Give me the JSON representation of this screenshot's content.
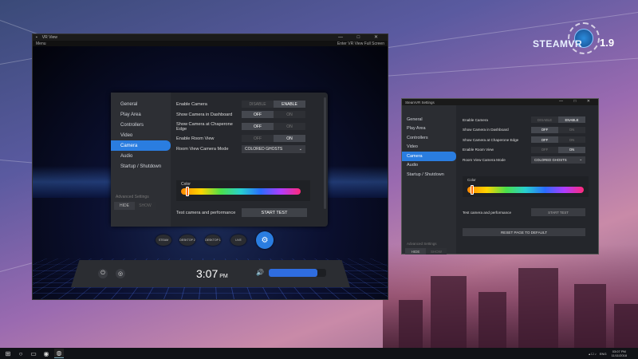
{
  "colors": {
    "accent": "#2a7de0",
    "volume": "#2f6de0"
  },
  "logo": {
    "word": "STEAMVR",
    "version": "1.9"
  },
  "vrview": {
    "title": "VR View",
    "menu_label": "Menu",
    "right_menu": "Enter VR View    Full Screen",
    "window_controls": "— □ ✕"
  },
  "vr_panel": {
    "nav": [
      "General",
      "Play Area",
      "Controllers",
      "Video",
      "Camera",
      "Audio",
      "Startup / Shutdown"
    ],
    "active_index": 4,
    "advanced_label": "Advanced Settings",
    "hide_label": "HIDE",
    "show_label": "SHOW",
    "rows": [
      {
        "label": "Enable Camera",
        "off": "DISABLE",
        "on": "ENABLE",
        "state": "on"
      },
      {
        "label": "Show Camera in Dashboard",
        "off": "OFF",
        "on": "ON",
        "state": "off"
      },
      {
        "label": "Show Camera at Chaperone Edge",
        "off": "OFF",
        "on": "ON",
        "state": "off"
      },
      {
        "label": "Enable Room View",
        "off": "OFF",
        "on": "ON",
        "state": "on"
      }
    ],
    "mode_label": "Room View Camera Mode",
    "mode_value": "COLORED GHOSTS",
    "color_label": "Color",
    "test_label": "Test camera and performance",
    "test_button": "START TEST"
  },
  "dashboard": {
    "buttons": [
      "STEAM",
      "DESKTOP 2",
      "DESKTOP 1",
      "LIVE"
    ],
    "settings_label": "SETTINGS",
    "time": "3:07",
    "ampm": "PM",
    "volume_fraction": 0.85
  },
  "settings_window": {
    "title": "SteamVR Settings",
    "window_controls": "— □ ✕",
    "nav": [
      "General",
      "Play Area",
      "Controllers",
      "Video",
      "Camera",
      "Audio",
      "Startup / Shutdown"
    ],
    "active_index": 4,
    "advanced_label": "Advanced Settings",
    "hide_label": "HIDE",
    "show_label": "SHOW",
    "rows": [
      {
        "label": "Enable Camera",
        "off": "DISABLE",
        "on": "ENABLE",
        "state": "on"
      },
      {
        "label": "Show Camera in Dashboard",
        "off": "OFF",
        "on": "ON",
        "state": "off"
      },
      {
        "label": "Show Camera at Chaperone Edge",
        "off": "OFF",
        "on": "ON",
        "state": "off"
      },
      {
        "label": "Enable Room View",
        "off": "OFF",
        "on": "ON",
        "state": "on"
      }
    ],
    "mode_label": "Room View Camera Mode",
    "mode_value": "COLORED GHOSTS",
    "color_label": "Color",
    "test_label": "Test camera and performance",
    "test_button": "START TEST",
    "reset_button": "RESET PAGE TO DEFAULT"
  },
  "taskbar": {
    "language": "ENG",
    "time": "03:07 PM",
    "date": "11/11/2018"
  }
}
